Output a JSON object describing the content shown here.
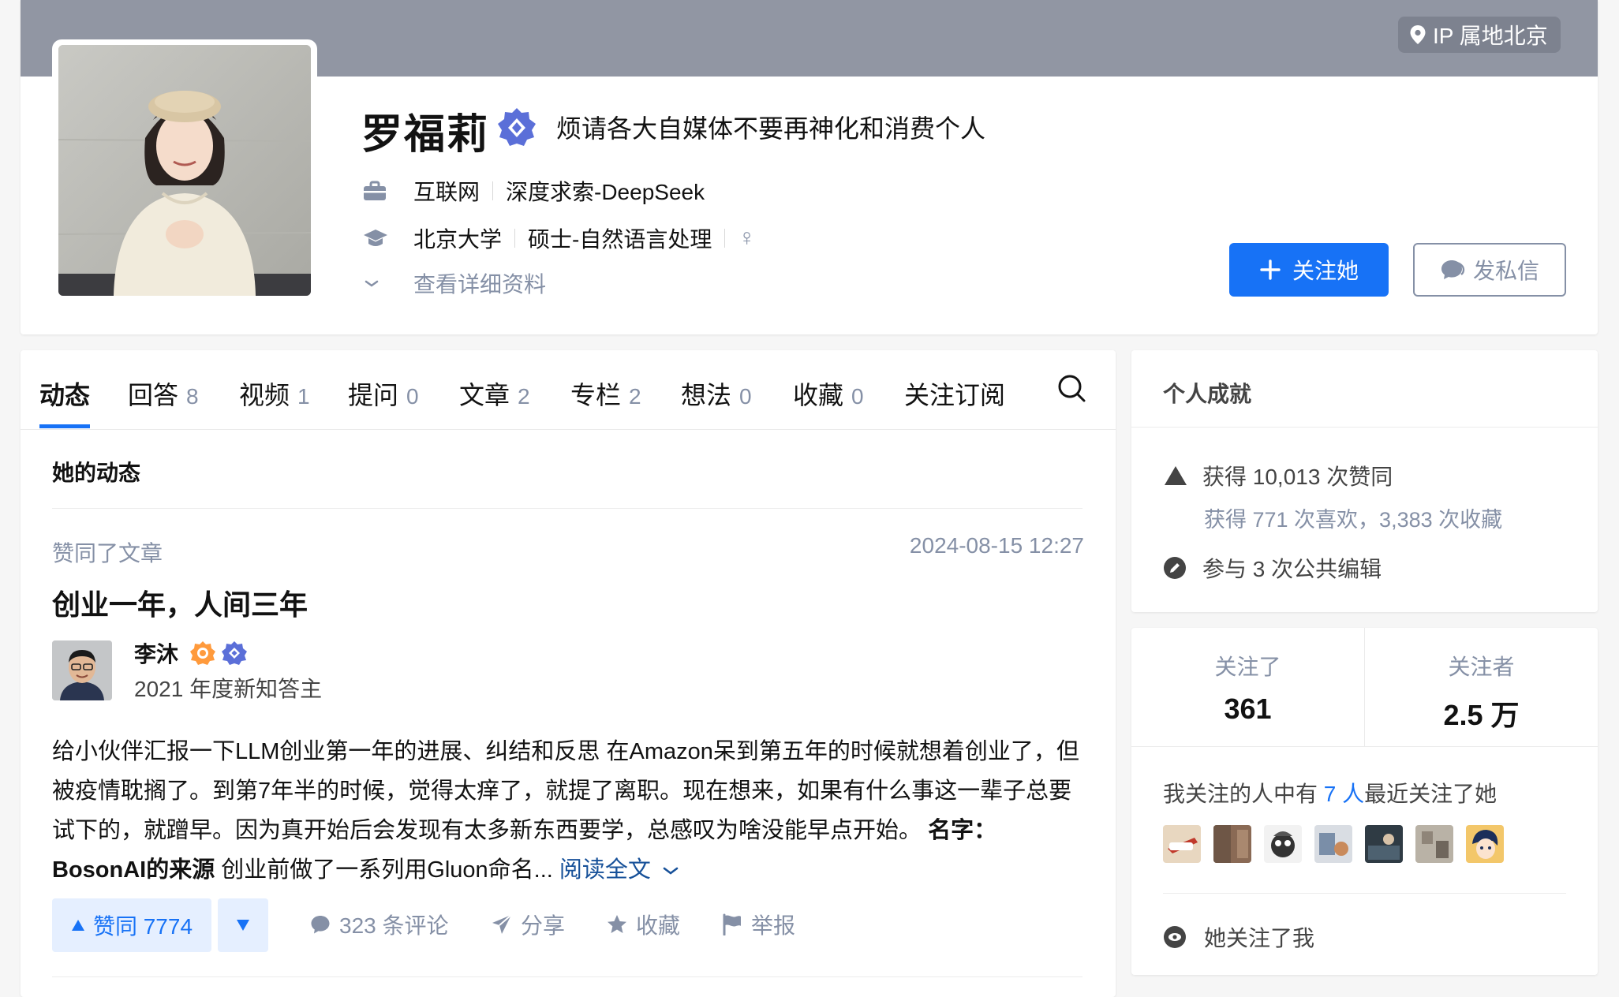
{
  "header": {
    "ip_location": "IP 属地北京",
    "name": "罗福莉",
    "headline": "烦请各大自媒体不要再神化和消费个人",
    "industry": "互联网",
    "company": "深度求索-DeepSeek",
    "school": "北京大学",
    "major": "硕士-自然语言处理",
    "gender_symbol": "♀",
    "more_info": "查看详细资料",
    "follow_button": "关注她",
    "message_button": "发私信"
  },
  "tabs": [
    {
      "label": "动态",
      "count": ""
    },
    {
      "label": "回答",
      "count": "8"
    },
    {
      "label": "视频",
      "count": "1"
    },
    {
      "label": "提问",
      "count": "0"
    },
    {
      "label": "文章",
      "count": "2"
    },
    {
      "label": "专栏",
      "count": "2"
    },
    {
      "label": "想法",
      "count": "0"
    },
    {
      "label": "收藏",
      "count": "0"
    },
    {
      "label": "关注订阅",
      "count": ""
    }
  ],
  "feed": {
    "section_title": "她的动态",
    "item": {
      "action": "赞同了文章",
      "time": "2024-08-15 12:27",
      "title": "创业一年，人间三年",
      "author_name": "李沐",
      "author_bio": "2021 年度新知答主",
      "excerpt_p1": "给小伙伴汇报一下LLM创业第一年的进展、纠结和反思 在Amazon呆到第五年的时候就想着创业了，但被疫情耽搁了。到第7年半的时候，觉得太痒了，就提了离职。现在想来，如果有什么事这一辈子总要试下的，就蹭早。因为真开始后会发现有太多新东西要学，总感叹为啥没能早点开始。",
      "excerpt_bold": "名字：BosonAI的来源",
      "excerpt_p2": "创业前做了一系列用Gluon命名...",
      "read_more": "阅读全文",
      "vote_up": "赞同 7774",
      "comments": "323 条评论",
      "share": "分享",
      "collect": "收藏",
      "report": "举报"
    }
  },
  "achievements": {
    "title": "个人成就",
    "upvotes": "获得 10,013 次赞同",
    "likes_collects": "获得 771 次喜欢，3,383 次收藏",
    "edits": "参与 3 次公共编辑"
  },
  "follow_stats": {
    "following_label": "关注了",
    "following_count": "361",
    "followers_label": "关注者",
    "followers_count": "2.5 万",
    "mutual_prefix": "我关注的人中有",
    "mutual_count": "7 人",
    "mutual_suffix": "最近关注了她",
    "follows_me": "她关注了我"
  },
  "colors": {
    "brand_blue": "#1772f6",
    "banner_gray": "#9196a3",
    "muted_text": "#8590a6"
  },
  "icons": [
    "location-pin-icon",
    "verified-badge-icon",
    "briefcase-icon",
    "graduation-cap-icon",
    "female-icon",
    "chevron-down-icon",
    "plus-icon",
    "chat-bubble-icon",
    "search-icon",
    "triangle-up-icon",
    "triangle-down-icon",
    "comment-icon",
    "share-icon",
    "star-icon",
    "flag-icon",
    "upvote-icon",
    "pencil-icon",
    "eye-icon"
  ]
}
